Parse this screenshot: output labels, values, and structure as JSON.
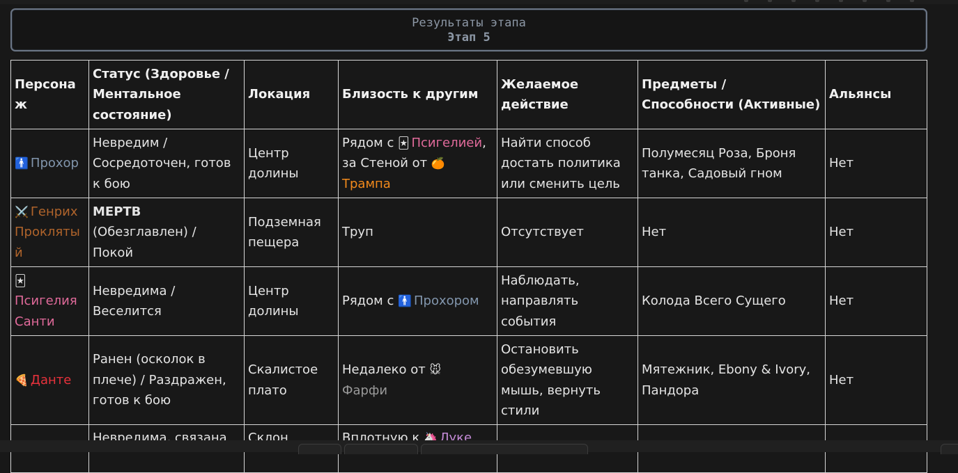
{
  "header": {
    "title": "Результаты этапа",
    "subtitle": "Этап 5"
  },
  "table": {
    "columns": [
      "Персонаж",
      "Статус (Здоровье / Ментальное состояние)",
      "Локация",
      "Близость к другим",
      "Желаемое действие",
      "Предметы / Способности (Активные)",
      "Альянсы"
    ],
    "rows": [
      {
        "icon": "🚹",
        "name": "Прохор",
        "status": "Невредим / Сосредоточен, готов к бою",
        "location": "Центр долины",
        "proximity": {
          "prefix": "Рядом с ",
          "icon1": "🃏",
          "name1": "Псигелией",
          "middle": ", за Стеной от ",
          "icon2": "🍊",
          "name2": "Трампа"
        },
        "action": "Найти способ достать политика или сменить цель",
        "items": "Полумесяц Роза, Броня танка, Садовый гном",
        "alliances": "Нет"
      },
      {
        "icon": "⚔️",
        "name": "Генрих Проклятый",
        "status_bold": "МЕРТВ",
        "status_rest": " (Обезглавлен) / Покой",
        "location": "Подземная пещера",
        "proximity": "Труп",
        "action": "Отсутствует",
        "items": "Нет",
        "alliances": "Нет"
      },
      {
        "icon": "🃏",
        "name": "Псигелия Санти",
        "status": "Невредима / Веселится",
        "location": "Центр долины",
        "proximity": {
          "prefix": "Рядом с ",
          "icon1": "🚹",
          "name1": "Прохором"
        },
        "action": "Наблюдать, направлять события",
        "items": "Колода Всего Сущего",
        "alliances": "Нет"
      },
      {
        "icon": "🍕",
        "name": "Данте",
        "status": "Ранен (осколок в плече) / Раздражен, готов к бою",
        "location": "Скалистое плато",
        "proximity": {
          "prefix": "Недалеко от ",
          "icon1": "🐭",
          "name1": "Фарфи"
        },
        "action": "Остановить обезумевшую мышь, вернуть стили",
        "items": "Мятежник, Ebony & Ivory, Пандора",
        "alliances": "Нет"
      },
      {
        "status": "Невредима, связана",
        "location": "Склон",
        "proximity": {
          "prefix": "Вплотную к ",
          "icon1": "🦄",
          "name1": "Луке"
        }
      }
    ]
  },
  "colors": {
    "background": "#181818",
    "border": "#d8d8d8",
    "header_text": "#8c97a5",
    "prokhor": "#8296ad",
    "genrikh": "#b0642b",
    "psigelia": "#e06a9a",
    "dante": "#e8323c",
    "trump": "#f28a1c",
    "farfi": "#9a9a9a",
    "luka": "#c58bd8"
  }
}
